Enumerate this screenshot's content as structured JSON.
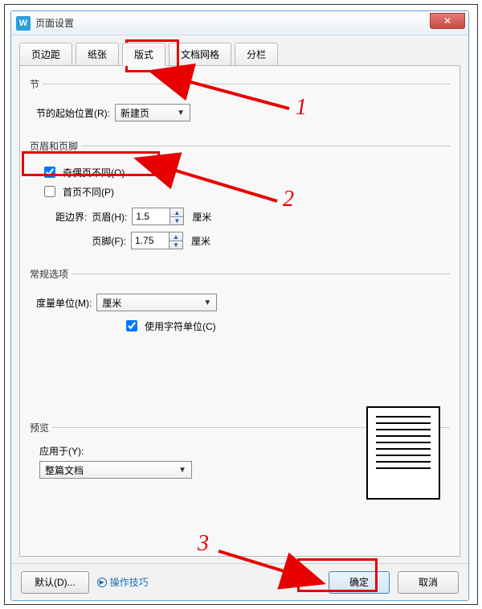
{
  "window": {
    "title": "页面设置",
    "app_icon_letter": "W"
  },
  "tabs": {
    "margins": "页边距",
    "paper": "纸张",
    "layout": "版式",
    "grid": "文档网格",
    "columns": "分栏",
    "active_index": 2
  },
  "section": {
    "legend": "节",
    "start_label": "节的起始位置(R):",
    "start_value": "新建页"
  },
  "headerfooter": {
    "legend": "页眉和页脚",
    "odd_even_label": "奇偶页不同(O)",
    "odd_even_checked": true,
    "first_page_label": "首页不同(P)",
    "first_page_checked": false,
    "distance_prefix": "距边界:",
    "header_label": "页眉(H):",
    "header_value": "1.5",
    "footer_label": "页脚(F):",
    "footer_value": "1.75",
    "unit": "厘米"
  },
  "general": {
    "legend": "常规选项",
    "measure_label": "度量单位(M):",
    "measure_value": "厘米",
    "char_unit_label": "使用字符单位(C)",
    "char_unit_checked": true
  },
  "preview": {
    "legend": "预览",
    "apply_label": "应用于(Y):",
    "apply_value": "整篇文档"
  },
  "buttons": {
    "default": "默认(D)...",
    "tips": "操作技巧",
    "ok": "确定",
    "cancel": "取消"
  },
  "annotations": {
    "n1": "1",
    "n2": "2",
    "n3": "3"
  }
}
